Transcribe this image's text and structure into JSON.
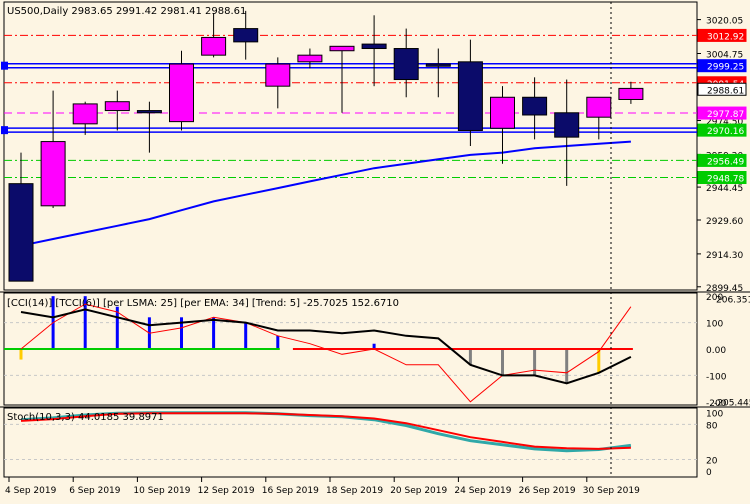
{
  "symbol_header": "US500,Daily  2983.65 2991.42 2981.41 2988.61",
  "colors": {
    "background": "#fdf5e3",
    "bull": "#ff00ff",
    "bear": "#0b0b6a",
    "ma": "#0000ff",
    "level_blue": "#0000ff",
    "level_red": "#ff0000",
    "level_green": "#00cc00",
    "level_magenta": "#ff00ff",
    "cci_line": "#000000",
    "cci_turbo": "#ff0000",
    "stoch_main": "#2fa8a8",
    "stoch_signal": "#ff0000",
    "bar_blue": "#0000ff",
    "bar_gray": "#808080",
    "bar_yellow": "#ffcc00"
  },
  "price_axis": {
    "ticks": [
      "3020.05",
      "3004.75",
      "2974.50",
      "2959.20",
      "2944.45",
      "2929.60",
      "2914.30",
      "2899.45"
    ],
    "level_labels": [
      {
        "text": "3012.92",
        "color": "#ff0000",
        "text_color": "#ffffff"
      },
      {
        "text": "2999.25",
        "color": "#0000ff",
        "text_color": "#ffffff"
      },
      {
        "text": "2991.54",
        "color": "#ff0000",
        "text_color": "#ffffff"
      },
      {
        "text": "2988.61",
        "color": "#ffffff",
        "text_color": "#000000"
      },
      {
        "text": "2977.87",
        "color": "#ff00ff",
        "text_color": "#ffffff"
      },
      {
        "text": "2970.16",
        "color": "#00cc00",
        "text_color": "#ffffff"
      },
      {
        "text": "2956.49",
        "color": "#00cc00",
        "text_color": "#ffffff"
      },
      {
        "text": "2948.78",
        "color": "#00cc00",
        "text_color": "#ffffff"
      }
    ]
  },
  "candles": [
    {
      "o": 2946,
      "h": 2960,
      "l": 2902,
      "c": 2902
    },
    {
      "o": 2936,
      "h": 2988,
      "l": 2935,
      "c": 2965
    },
    {
      "o": 2973,
      "h": 2983,
      "l": 2968,
      "c": 2982
    },
    {
      "o": 2979,
      "h": 2988,
      "l": 2970,
      "c": 2983
    },
    {
      "o": 2979,
      "h": 2983,
      "l": 2960,
      "c": 2978
    },
    {
      "o": 2974,
      "h": 3006,
      "l": 2970,
      "c": 3000
    },
    {
      "o": 3004,
      "h": 3023,
      "l": 3003,
      "c": 3012
    },
    {
      "o": 3016,
      "h": 3024,
      "l": 3002,
      "c": 3010
    },
    {
      "o": 2990,
      "h": 3003,
      "l": 2980,
      "c": 3000
    },
    {
      "o": 3001,
      "h": 3007,
      "l": 2998,
      "c": 3004
    },
    {
      "o": 3006,
      "h": 3008,
      "l": 2978,
      "c": 3008
    },
    {
      "o": 3009,
      "h": 3022,
      "l": 2990,
      "c": 3007
    },
    {
      "o": 3007,
      "h": 3016,
      "l": 2985,
      "c": 2993
    },
    {
      "o": 3000,
      "h": 3007,
      "l": 2985,
      "c": 2999
    },
    {
      "o": 3001,
      "h": 3011,
      "l": 2963,
      "c": 2970
    },
    {
      "o": 2971,
      "h": 2990,
      "l": 2955,
      "c": 2985
    },
    {
      "o": 2985,
      "h": 2994,
      "l": 2966,
      "c": 2977
    },
    {
      "o": 2978,
      "h": 2993,
      "l": 2945,
      "c": 2967
    },
    {
      "o": 2976,
      "h": 2985,
      "l": 2966,
      "c": 2985
    },
    {
      "o": 2984,
      "h": 2992,
      "l": 2982,
      "c": 2989
    }
  ],
  "ma_values": [
    2918,
    2921,
    2924,
    2927,
    2930,
    2934,
    2938,
    2941,
    2944,
    2947,
    2950,
    2953,
    2955,
    2957,
    2959,
    2960,
    2962,
    2963,
    2964,
    2965
  ],
  "levels": [
    {
      "price": 3012.92,
      "style": "dashdot",
      "color": "#ff0000",
      "width": 1
    },
    {
      "price": 2999.25,
      "style": "double",
      "color": "#0000ff",
      "width": 2
    },
    {
      "price": 2991.54,
      "style": "dashdot",
      "color": "#ff0000",
      "width": 1
    },
    {
      "price": 2977.87,
      "style": "dashed",
      "color": "#ff00ff",
      "width": 1
    },
    {
      "price": 2970.16,
      "style": "double",
      "color": "#0000ff",
      "width": 2
    },
    {
      "price": 2956.49,
      "style": "dashdot",
      "color": "#00cc00",
      "width": 1
    },
    {
      "price": 2948.78,
      "style": "dashdot",
      "color": "#00cc00",
      "width": 1
    }
  ],
  "cci_panel": {
    "header": "[CCI(14)] [TCCI(6)] [per LSMA: 25] [per EMA: 34] [Trend: 5]  -25.7025 152.6710",
    "axis_ticks": [
      "200",
      "100",
      "0.00",
      "-100",
      "-200"
    ],
    "axis_top_label": "206.3511",
    "axis_bottom_label": "-205.4453",
    "cci": [
      140,
      120,
      150,
      120,
      90,
      100,
      110,
      100,
      70,
      70,
      60,
      70,
      50,
      40,
      -60,
      -100,
      -100,
      -130,
      -90,
      -30
    ],
    "tcci": [
      0,
      100,
      170,
      140,
      60,
      80,
      120,
      100,
      50,
      20,
      -20,
      0,
      -60,
      -60,
      -200,
      -100,
      -80,
      -90,
      -10,
      160
    ],
    "hist": [
      {
        "v": -40,
        "c": "#ffcc00"
      },
      {
        "v": 200,
        "c": "#0000ff"
      },
      {
        "v": 200,
        "c": "#0000ff"
      },
      {
        "v": 160,
        "c": "#0000ff"
      },
      {
        "v": 120,
        "c": "#0000ff"
      },
      {
        "v": 120,
        "c": "#0000ff"
      },
      {
        "v": 120,
        "c": "#0000ff"
      },
      {
        "v": 100,
        "c": "#0000ff"
      },
      {
        "v": 50,
        "c": "#0000ff"
      },
      {
        "v": 0,
        "c": "#0000ff"
      },
      {
        "v": 0,
        "c": "#0000ff"
      },
      {
        "v": 20,
        "c": "#0000ff"
      },
      {
        "v": 0,
        "c": "#0000ff"
      },
      {
        "v": 0,
        "c": "#0000ff"
      },
      {
        "v": -60,
        "c": "#808080"
      },
      {
        "v": -100,
        "c": "#808080"
      },
      {
        "v": -100,
        "c": "#808080"
      },
      {
        "v": -130,
        "c": "#808080"
      },
      {
        "v": -90,
        "c": "#ffcc00"
      },
      {
        "v": 0,
        "c": "#808080"
      }
    ],
    "zero_segments": [
      {
        "from": 0,
        "to": 8,
        "color": "#00cc00"
      },
      {
        "from": 9,
        "to": 19,
        "color": "#ff0000"
      }
    ]
  },
  "stoch_panel": {
    "header": "Stoch(10,3,3) 44.0185 39.8971",
    "axis_ticks": [
      "100",
      "80",
      "20",
      "0"
    ],
    "main": [
      88,
      91,
      96,
      99,
      100,
      100,
      100,
      100,
      98,
      95,
      93,
      88,
      78,
      64,
      52,
      45,
      38,
      35,
      37,
      44
    ],
    "signal": [
      86,
      89,
      94,
      98,
      99,
      99,
      99,
      99,
      98,
      96,
      94,
      90,
      82,
      70,
      58,
      50,
      42,
      39,
      38,
      40
    ]
  },
  "date_labels": [
    "4 Sep 2019",
    "6 Sep 2019",
    "10 Sep 2019",
    "12 Sep 2019",
    "16 Sep 2019",
    "18 Sep 2019",
    "20 Sep 2019",
    "24 Sep 2019",
    "26 Sep 2019",
    "30 Sep 2019"
  ]
}
